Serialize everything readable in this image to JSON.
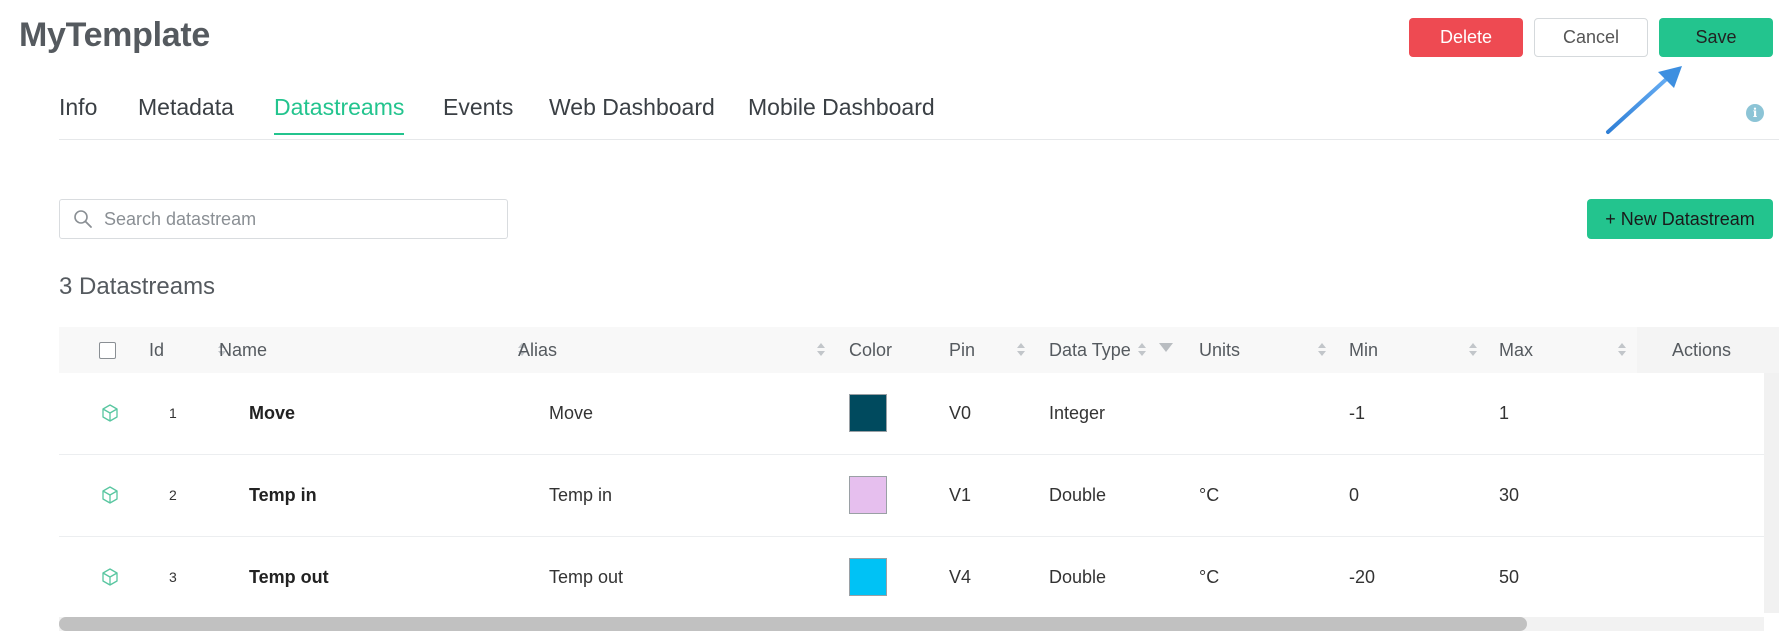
{
  "header": {
    "title": "MyTemplate",
    "delete_label": "Delete",
    "cancel_label": "Cancel",
    "save_label": "Save"
  },
  "tabs": [
    {
      "label": "Info",
      "active": false
    },
    {
      "label": "Metadata",
      "active": false
    },
    {
      "label": "Datastreams",
      "active": true
    },
    {
      "label": "Events",
      "active": false
    },
    {
      "label": "Web Dashboard",
      "active": false
    },
    {
      "label": "Mobile Dashboard",
      "active": false
    }
  ],
  "search": {
    "placeholder": "Search datastream",
    "value": ""
  },
  "new_button_label": "+ New Datastream",
  "datastream_count": "3 Datastreams",
  "table": {
    "headers": {
      "id": "Id",
      "name": "Name",
      "alias": "Alias",
      "color": "Color",
      "pin": "Pin",
      "data_type": "Data Type",
      "units": "Units",
      "min": "Min",
      "max": "Max",
      "actions": "Actions"
    },
    "rows": [
      {
        "id": "1",
        "name": "Move",
        "alias": "Move",
        "color": "#004a5e",
        "pin": "V0",
        "data_type": "Integer",
        "units": "",
        "min": "-1",
        "max": "1"
      },
      {
        "id": "2",
        "name": "Temp in",
        "alias": "Temp in",
        "color": "#e6bfee",
        "pin": "V1",
        "data_type": "Double",
        "units": "°C",
        "min": "0",
        "max": "30"
      },
      {
        "id": "3",
        "name": "Temp out",
        "alias": "Temp out",
        "color": "#00c2f5",
        "pin": "V4",
        "data_type": "Double",
        "units": "°C",
        "min": "-20",
        "max": "50"
      }
    ]
  },
  "theme": {
    "accent": "#23c48e",
    "danger": "#ee4a52",
    "annotation_arrow": "#3d8fe0"
  },
  "icons": {
    "search": "search-icon",
    "info": "info-icon",
    "datastream": "cube-icon",
    "filter": "filter-icon",
    "sort": "sort-icon"
  }
}
